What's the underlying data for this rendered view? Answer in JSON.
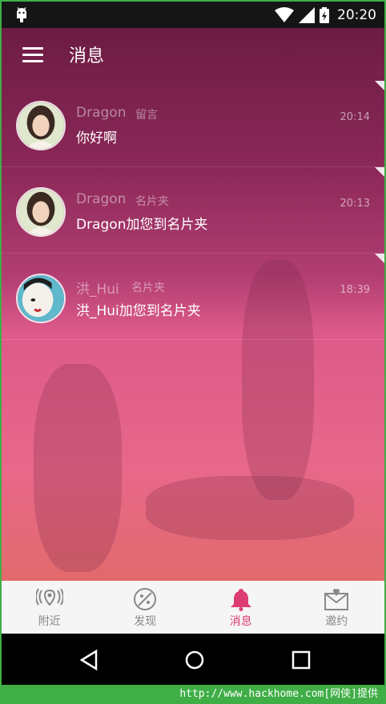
{
  "statusbar": {
    "time": "20:20"
  },
  "toolbar": {
    "title": "消息"
  },
  "messages": [
    {
      "name": "Dragon",
      "tag": "留言",
      "text": "你好啊",
      "time": "20:14"
    },
    {
      "name": "Dragon",
      "tag": "名片夹",
      "text": "Dragon加您到名片夹",
      "time": "20:13"
    },
    {
      "name": "洪_Hui",
      "tag": "名片夹",
      "text": "洪_Hui加您到名片夹",
      "time": "18:39"
    }
  ],
  "tabs": [
    {
      "label": "附近",
      "icon": "nearby-radar-icon",
      "active": false
    },
    {
      "label": "发现",
      "icon": "discover-compass-icon",
      "active": false
    },
    {
      "label": "消息",
      "icon": "bell-icon",
      "active": true
    },
    {
      "label": "邀约",
      "icon": "invite-envelope-icon",
      "active": false
    }
  ],
  "colors": {
    "accent": "#dc3d72",
    "tab_inactive": "#888888",
    "footer": "#3fae46"
  },
  "footer": {
    "text": "http://www.hackhome.com[网侠]提供"
  }
}
